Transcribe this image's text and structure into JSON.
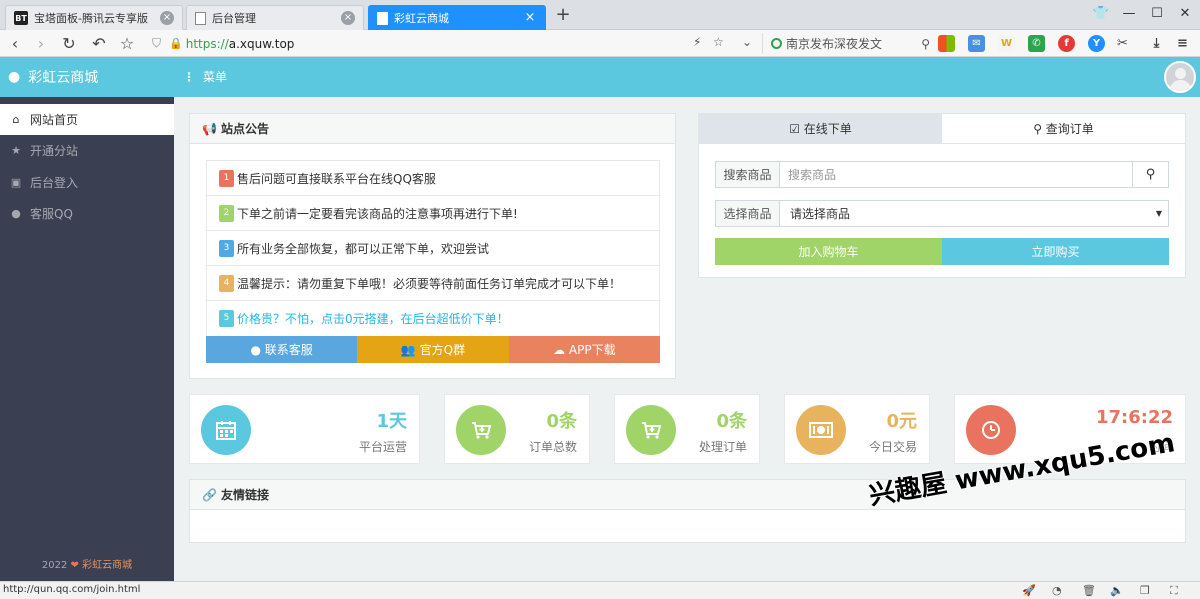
{
  "browser": {
    "tabs": [
      {
        "label": "宝塔面板-腾讯云专享版",
        "favicon": "BT"
      },
      {
        "label": "后台管理"
      },
      {
        "label": "彩虹云商城"
      }
    ],
    "new_tab": "+",
    "url_protocol": "https://",
    "url_host": "a.xquw.top",
    "search_placeholder": "南京发布深夜发文"
  },
  "header": {
    "brand": "彩虹云商城",
    "menu_label": "菜单"
  },
  "sidebar": {
    "items": [
      {
        "label": "网站首页",
        "icon": "home-icon"
      },
      {
        "label": "开通分站",
        "icon": "star-icon"
      },
      {
        "label": "后台登入",
        "icon": "lock-icon"
      },
      {
        "label": "客服QQ",
        "icon": "qq-icon"
      }
    ],
    "footer_year": "2022",
    "footer_brand": "彩虹云商城"
  },
  "notice": {
    "title": "站点公告",
    "items": [
      {
        "num": "1",
        "text": "售后问题可直接联系平台在线QQ客服",
        "color": "#e9735f"
      },
      {
        "num": "2",
        "text": "下单之前请一定要看完该商品的注意事项再进行下单!",
        "color": "#a0d468"
      },
      {
        "num": "3",
        "text": "所有业务全部恢复，都可以正常下单，欢迎尝试",
        "color": "#4fa9e3"
      },
      {
        "num": "4",
        "text": "温馨提示：请勿重复下单哦！必须要等待前面任务订单完成才可以下单！",
        "color": "#e8b35d"
      },
      {
        "num": "5",
        "text": "价格贵？不怕，点击0元搭建，在后台超低价下单！",
        "color": "#5bc8e0"
      }
    ],
    "buttons": [
      {
        "label": "联系客服",
        "color": "#5aa7e0"
      },
      {
        "label": "官方Q群",
        "color": "#e4a413"
      },
      {
        "label": "APP下载",
        "color": "#e9835f"
      }
    ]
  },
  "order": {
    "tabs": [
      "在线下单",
      "查询订单"
    ],
    "search_label": "搜索商品",
    "search_placeholder": "搜索商品",
    "select_label": "选择商品",
    "select_value": "请选择商品",
    "add_cart": "加入购物车",
    "buy_now": "立即购买"
  },
  "stats": [
    {
      "value": "1天",
      "label": "平台运营",
      "color": "#5bc8e0",
      "icon": "calendar-icon"
    },
    {
      "value": "0条",
      "label": "订单总数",
      "color": "#a0d468",
      "icon": "cart-icon"
    },
    {
      "value": "0条",
      "label": "处理订单",
      "color": "#a0d468",
      "icon": "cart-icon"
    },
    {
      "value": "0元",
      "label": "今日交易",
      "color": "#e8b35d",
      "icon": "money-icon"
    },
    {
      "value": "17:6:22",
      "label": "时间",
      "color": "#e9735f",
      "icon": "clock-icon"
    }
  ],
  "links": {
    "title": "友情链接"
  },
  "watermark": "兴趣屋 www.xqu5.com",
  "status_url": "http://qun.qq.com/join.html",
  "colors": {
    "header": "#5bc8e0",
    "sidebar": "#3a3f51",
    "active_tab": "#1e90ff"
  }
}
